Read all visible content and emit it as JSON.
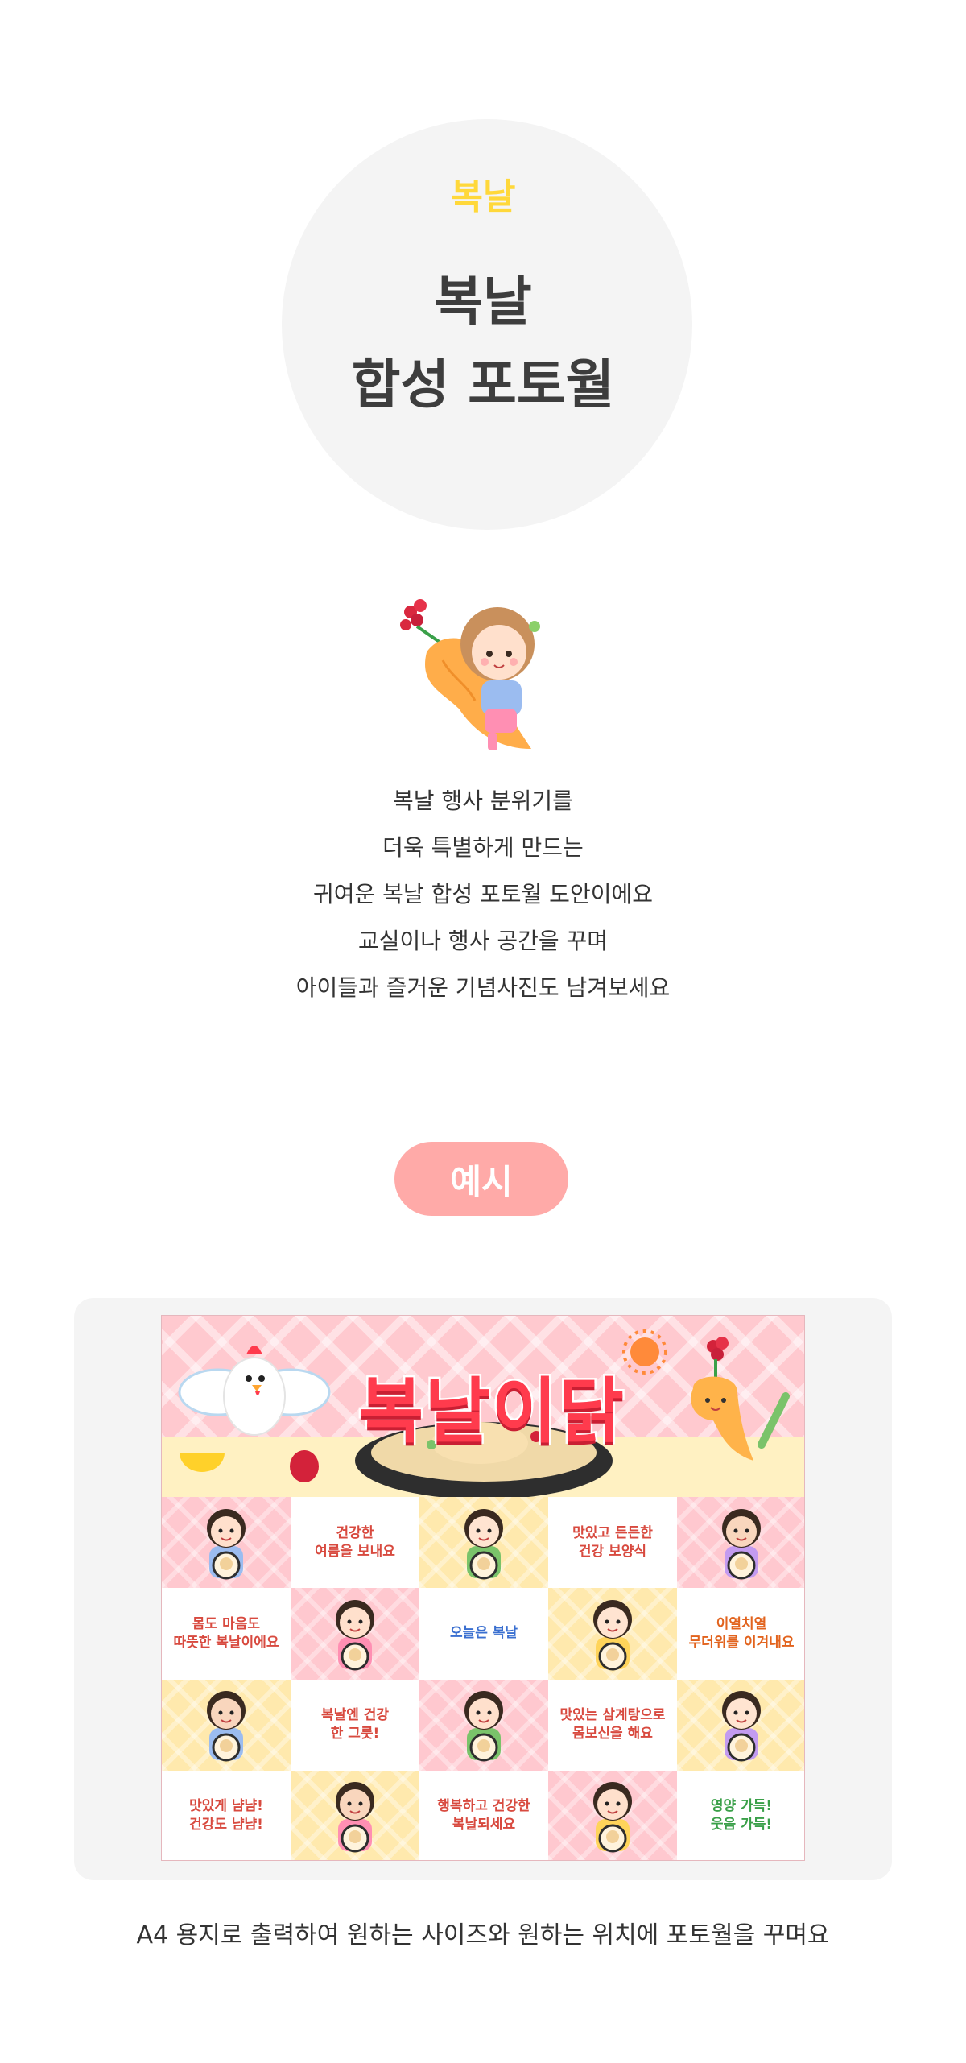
{
  "hero": {
    "subtitle": "복날",
    "title_line1": "복날",
    "title_line2": "합성 포토월"
  },
  "mascot_icon": "girl-holding-ginseng-icon",
  "description": [
    "복날 행사 분위기를",
    "더욱 특별하게 만드는",
    "귀여운 복날 합성 포토월 도안이에요",
    "교실이나 행사 공간을 꾸며",
    "아이들과 즐거운 기념사진도 남겨보세요"
  ],
  "example_label": "예시",
  "poster": {
    "title": "복날이닭",
    "cells": [
      {
        "type": "photo",
        "bg": "pink"
      },
      {
        "type": "text",
        "bg": "white",
        "text": "건강한\n여름을 보내요",
        "colors": [
          "#d84a3f",
          "#3a6fd0"
        ]
      },
      {
        "type": "photo",
        "bg": "yellow"
      },
      {
        "type": "text",
        "bg": "white",
        "text": "맛있고 든든한\n건강 보양식",
        "colors": [
          "#d84a3f",
          "#3a6fd0"
        ]
      },
      {
        "type": "photo",
        "bg": "pink"
      },
      {
        "type": "text",
        "bg": "white",
        "text": "몸도 마음도\n따뜻한 복날이에요",
        "colors": [
          "#d84a3f",
          "#3a6fd0"
        ]
      },
      {
        "type": "photo",
        "bg": "pink"
      },
      {
        "type": "text",
        "bg": "white",
        "text": "오늘은 복날",
        "colors": [
          "#3a6fd0",
          "#3a6fd0"
        ]
      },
      {
        "type": "photo",
        "bg": "yellow"
      },
      {
        "type": "text",
        "bg": "white",
        "text": "이열치열\n무더위를 이겨내요",
        "colors": [
          "#e2631d",
          "#3a6fd0"
        ]
      },
      {
        "type": "photo",
        "bg": "yellow"
      },
      {
        "type": "text",
        "bg": "white",
        "text": "복날엔 건강\n한 그릇!",
        "colors": [
          "#d84a3f",
          "#3a6fd0"
        ]
      },
      {
        "type": "photo",
        "bg": "pink"
      },
      {
        "type": "text",
        "bg": "white",
        "text": "맛있는 삼계탕으로\n몸보신을 해요",
        "colors": [
          "#d84a3f",
          "#3a6fd0"
        ]
      },
      {
        "type": "photo",
        "bg": "yellow"
      },
      {
        "type": "text",
        "bg": "white",
        "text": "맛있게 냠냠!\n건강도 냠냠!",
        "colors": [
          "#d84a3f",
          "#3a6fd0"
        ]
      },
      {
        "type": "photo",
        "bg": "yellow"
      },
      {
        "type": "text",
        "bg": "white",
        "text": "행복하고 건강한\n복날되세요",
        "colors": [
          "#d84a3f",
          "#3a6fd0"
        ]
      },
      {
        "type": "photo",
        "bg": "pink"
      },
      {
        "type": "text",
        "bg": "white",
        "text": "영양 가득!\n웃음 가득!",
        "colors": [
          "#3aa049",
          "#e2631d"
        ]
      }
    ]
  },
  "caption": "A4 용지로 출력하여 원하는 사이즈와 원하는 위치에 포토월을 꾸며요"
}
